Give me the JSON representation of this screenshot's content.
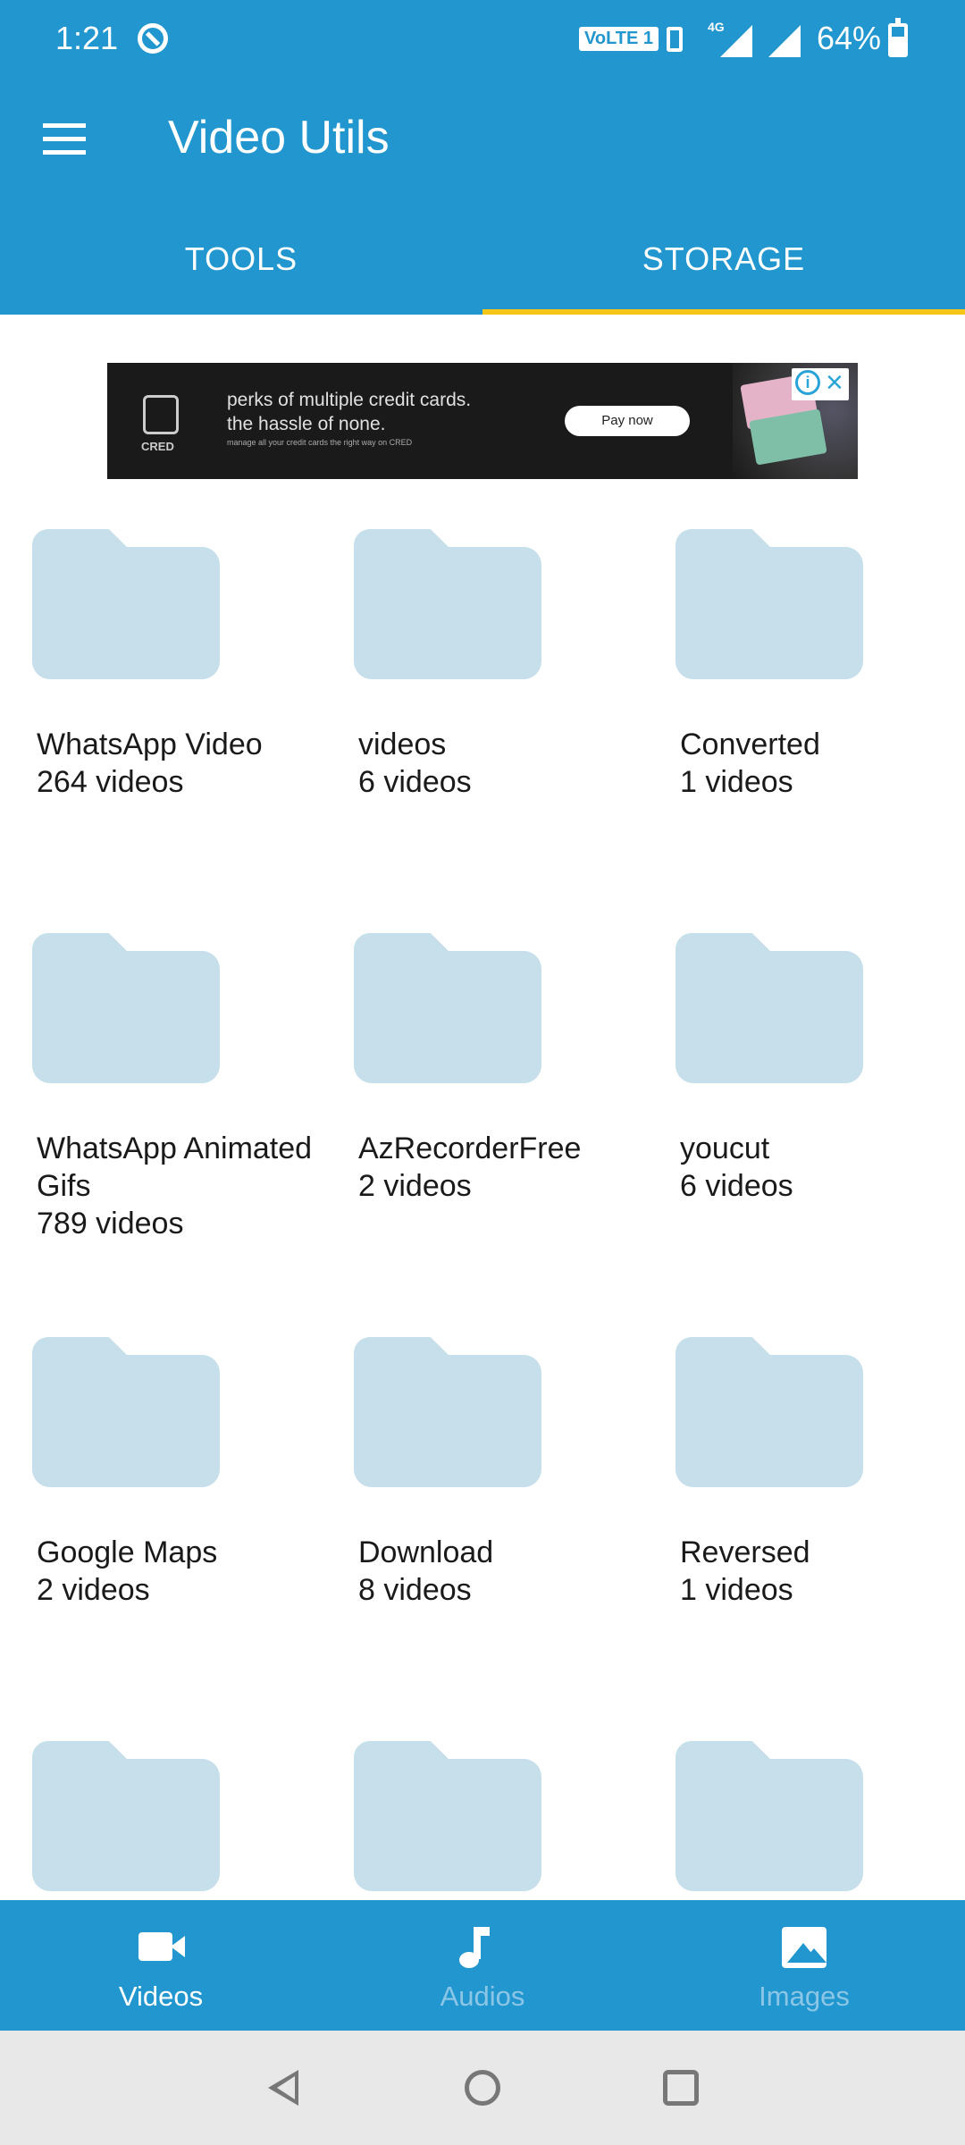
{
  "status_bar": {
    "time": "1:21",
    "volte_label": "VoLTE 1",
    "network_label": "4G",
    "battery": "64%",
    "battery_level": 0.64
  },
  "app_bar": {
    "title": "Video Utils",
    "menu_icon": "hamburger-menu-icon"
  },
  "tabs": [
    {
      "label": "TOOLS",
      "selected": false
    },
    {
      "label": "STORAGE",
      "selected": true
    }
  ],
  "ad": {
    "logo_text": "CRED",
    "headline_1": "perks of multiple credit cards.",
    "headline_2": "the hassle of none.",
    "subtext": "manage all your credit cards the right way on CRED",
    "cta": "Pay now"
  },
  "folders": [
    {
      "name": "WhatsApp Video",
      "count": "264 videos"
    },
    {
      "name": "videos",
      "count": "6 videos"
    },
    {
      "name": "Converted",
      "count": "1 videos"
    },
    {
      "name": "WhatsApp Animated Gifs",
      "count": "789 videos"
    },
    {
      "name": "AzRecorderFree",
      "count": "2 videos"
    },
    {
      "name": "youcut",
      "count": "6 videos"
    },
    {
      "name": "Google Maps",
      "count": "2 videos"
    },
    {
      "name": "Download",
      "count": "8 videos"
    },
    {
      "name": "Reversed",
      "count": "1 videos"
    },
    {
      "name": "",
      "count": ""
    },
    {
      "name": "",
      "count": ""
    },
    {
      "name": "",
      "count": ""
    }
  ],
  "bottom_nav": [
    {
      "label": "Videos",
      "icon": "video-camera-icon",
      "active": true
    },
    {
      "label": "Audios",
      "icon": "music-note-icon",
      "active": false
    },
    {
      "label": "Images",
      "icon": "image-icon",
      "active": false
    }
  ],
  "colors": {
    "primary": "#2196cf",
    "tab_indicator": "#f5c518",
    "folder": "#c6dfeb"
  }
}
